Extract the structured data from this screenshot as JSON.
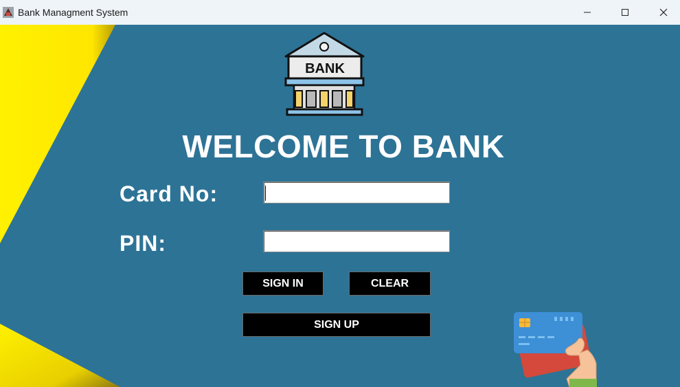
{
  "window": {
    "title": "Bank Managment System",
    "minimize_icon": "minimize-icon",
    "maximize_icon": "maximize-icon",
    "close_icon": "close-icon"
  },
  "logo": {
    "text": "BANK",
    "icon": "bank-building-icon"
  },
  "heading": "WELCOME TO BANK",
  "form": {
    "card_label": "Card No:",
    "card_value": "",
    "pin_label": "PIN:",
    "pin_value": ""
  },
  "buttons": {
    "sign_in": "SIGN IN",
    "clear": "CLEAR",
    "sign_up": "SIGN UP"
  },
  "colors": {
    "background": "#2d7396",
    "accent_yellow": "#fff100",
    "button": "#000000"
  }
}
